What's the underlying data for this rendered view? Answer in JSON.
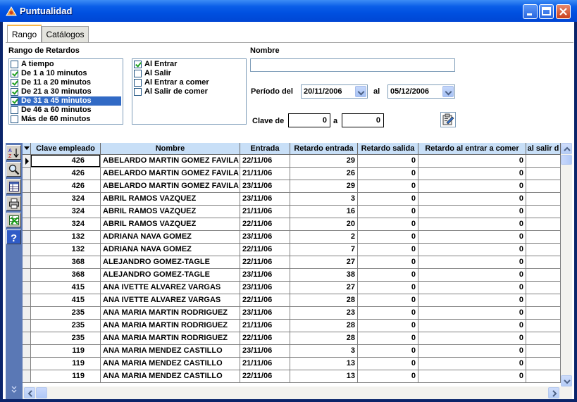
{
  "window": {
    "title": "Puntualidad"
  },
  "tabs": [
    {
      "label": "Rango"
    },
    {
      "label": "Catálogos"
    }
  ],
  "rango_retardos": {
    "label": "Rango de Retardos",
    "items": [
      {
        "label": "A tiempo",
        "checked": false
      },
      {
        "label": "De 1 a 10 minutos",
        "checked": true
      },
      {
        "label": "De 11 a 20 minutos",
        "checked": true
      },
      {
        "label": "De 21 a 30 minutos",
        "checked": true
      },
      {
        "label": "De 31 a 45 minutos",
        "checked": true
      },
      {
        "label": "De 46 a 60 minutos",
        "checked": false
      },
      {
        "label": "Más de 60 minutos",
        "checked": false
      }
    ],
    "selected_index": 4
  },
  "tipo_checada": {
    "items": [
      {
        "label": "Al Entrar",
        "checked": true
      },
      {
        "label": "Al Salir",
        "checked": false
      },
      {
        "label": "Al Entrar a comer",
        "checked": false
      },
      {
        "label": "Al Salir de comer",
        "checked": false
      }
    ]
  },
  "nombre": {
    "label": "Nombre",
    "value": ""
  },
  "periodo": {
    "label": "Período del",
    "from": "20/11/2006",
    "to_label": "al",
    "to": "05/12/2006"
  },
  "clave": {
    "label": "Clave de",
    "from": "0",
    "to_label": "a",
    "to": "0"
  },
  "grid": {
    "columns": [
      "Clave empleado",
      "Nombre",
      "Entrada",
      "Retardo entrada",
      "Retardo salida",
      "Retardo al entrar a comer",
      "al salir d"
    ],
    "rows": [
      [
        "426",
        "ABELARDO MARTIN GOMEZ FAVILA",
        "22/11/06",
        "29",
        "0",
        "0"
      ],
      [
        "426",
        "ABELARDO MARTIN GOMEZ FAVILA",
        "21/11/06",
        "26",
        "0",
        "0"
      ],
      [
        "426",
        "ABELARDO MARTIN GOMEZ FAVILA",
        "23/11/06",
        "29",
        "0",
        "0"
      ],
      [
        "324",
        "ABRIL RAMOS VAZQUEZ",
        "23/11/06",
        "3",
        "0",
        "0"
      ],
      [
        "324",
        "ABRIL RAMOS VAZQUEZ",
        "21/11/06",
        "16",
        "0",
        "0"
      ],
      [
        "324",
        "ABRIL RAMOS VAZQUEZ",
        "22/11/06",
        "20",
        "0",
        "0"
      ],
      [
        "132",
        "ADRIANA NAVA GOMEZ",
        "23/11/06",
        "2",
        "0",
        "0"
      ],
      [
        "132",
        "ADRIANA NAVA GOMEZ",
        "22/11/06",
        "7",
        "0",
        "0"
      ],
      [
        "368",
        "ALEJANDRO  GOMEZ-TAGLE",
        "22/11/06",
        "27",
        "0",
        "0"
      ],
      [
        "368",
        "ALEJANDRO  GOMEZ-TAGLE",
        "23/11/06",
        "38",
        "0",
        "0"
      ],
      [
        "415",
        "ANA IVETTE ALVAREZ  VARGAS",
        "23/11/06",
        "27",
        "0",
        "0"
      ],
      [
        "415",
        "ANA IVETTE ALVAREZ  VARGAS",
        "22/11/06",
        "28",
        "0",
        "0"
      ],
      [
        "235",
        "ANA MARIA MARTIN RODRIGUEZ",
        "23/11/06",
        "23",
        "0",
        "0"
      ],
      [
        "235",
        "ANA MARIA MARTIN RODRIGUEZ",
        "21/11/06",
        "28",
        "0",
        "0"
      ],
      [
        "235",
        "ANA MARIA MARTIN RODRIGUEZ",
        "22/11/06",
        "28",
        "0",
        "0"
      ],
      [
        "119",
        "ANA MARIA MENDEZ CASTILLO",
        "23/11/06",
        "3",
        "0",
        "0"
      ],
      [
        "119",
        "ANA MARIA MENDEZ CASTILLO",
        "21/11/06",
        "13",
        "0",
        "0"
      ],
      [
        "119",
        "ANA MARIA MENDEZ CASTILLO",
        "22/11/06",
        "13",
        "0",
        "0"
      ]
    ]
  },
  "toolbar_icons": [
    "sort-icon",
    "search-icon",
    "table-icon",
    "print-icon",
    "export-icon",
    "help-icon"
  ],
  "colors": {
    "title_bar": "#0a5ee8",
    "grid_header": "#c8dff7",
    "selection": "#316ac5"
  }
}
